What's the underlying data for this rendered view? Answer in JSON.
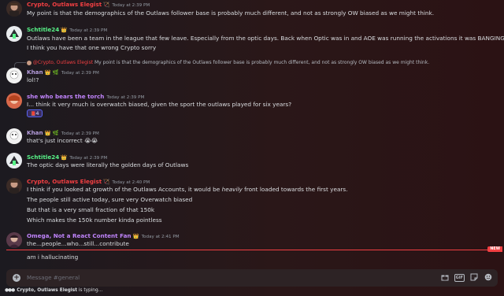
{
  "messages": [
    {
      "author": "Crypto, Outlaws Elegist",
      "author_color": "#f23f42",
      "badge": "🏹",
      "time": "Today at 2:39 PM",
      "lines": [
        "My point is that the demographics of the Outlaws follower base is probably much different, and not as strongly OW biased as we might think."
      ]
    },
    {
      "author": "Schtitle24",
      "author_color": "#57f287",
      "badge": "👑",
      "time": "Today at 2:39 PM",
      "lines": [
        "Outlaws have been a team in the league that few leave. Especially from the optic days. Back when Optic was in and AOE was running the activations it was BANGING",
        "I think you have that one wrong Crypto sorry"
      ]
    },
    {
      "reply": {
        "mention": "@Crypto, Outlaws Elegist",
        "text": "My point is that the demographics of the Outlaws follower base is probably much different, and not as strongly OW biased as we might think."
      },
      "author": "Khan",
      "author_color": "#b59ddc",
      "badge": "👑 🌿",
      "time": "Today at 2:39 PM",
      "lines": [
        "lol!?"
      ]
    },
    {
      "author": "she who bears the torch",
      "author_color": "#c084fc",
      "time": "Today at 2:39 PM",
      "lines": [
        "I... think it very much is overwatch biased, given the sport the outlaws played for six years?"
      ],
      "reaction": {
        "emoji": "📕",
        "count": "4"
      }
    },
    {
      "author": "Khan",
      "author_color": "#b59ddc",
      "badge": "👑 🌿",
      "time": "Today at 2:39 PM",
      "lines": [
        "that's just incorrect 😭😭"
      ]
    },
    {
      "author": "Schtitle24",
      "author_color": "#57f287",
      "badge": "👑",
      "time": "Today at 2:39 PM",
      "lines": [
        "The optic days were literally the golden days of Outlaws"
      ]
    },
    {
      "author": "Crypto, Outlaws Elegist",
      "author_color": "#f23f42",
      "badge": "🏹",
      "time": "Today at 2:40 PM",
      "lines_rich": [
        {
          "pre": "I think if you looked at growth of the Outlaws Accounts, it would be ",
          "em": "heavily",
          "post": " front loaded towards the first years."
        }
      ],
      "lines": [
        "The people still active today, sure very Overwatch biased",
        "But that is a very small fraction of that 150k",
        "Which makes the 150k number kinda pointless"
      ]
    },
    {
      "author": "Omega, Not a React Content Fan",
      "author_color": "#c084fc",
      "badge": "👑",
      "time": "Today at 2:41 PM",
      "lines": [
        "the...people...who...still...contribute",
        "am i hallucinating"
      ]
    }
  ],
  "divider": {
    "label": "NEW"
  },
  "composer": {
    "placeholder": "Message #general",
    "add_icon": "plus-circle-icon",
    "tools": [
      "gift-icon",
      "gif-icon",
      "sticker-icon",
      "emoji-icon"
    ],
    "gif_label": "GIF"
  },
  "typing": {
    "user": "Crypto, Outlaws Elegist",
    "text": " is typing..."
  }
}
